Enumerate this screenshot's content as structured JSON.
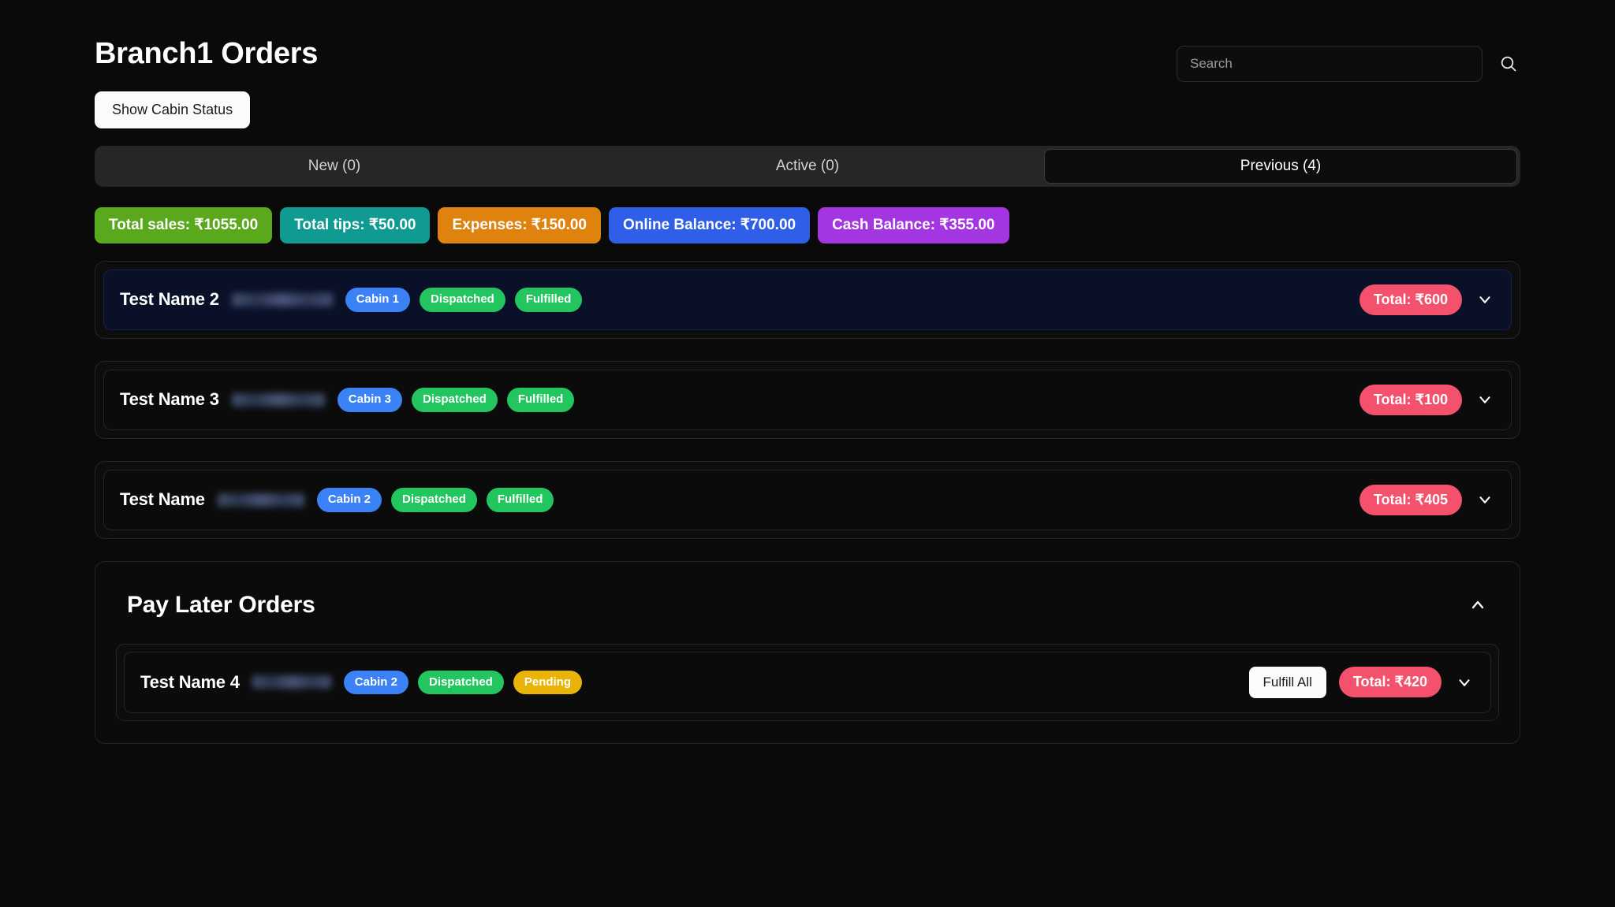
{
  "header": {
    "title": "Branch1 Orders",
    "search": {
      "placeholder": "Search",
      "value": ""
    },
    "search_icon": "search-icon"
  },
  "actions": {
    "show_cabin_status": "Show Cabin Status"
  },
  "tabs": [
    {
      "label": "New (0)",
      "active": false
    },
    {
      "label": "Active (0)",
      "active": false
    },
    {
      "label": "Previous (4)",
      "active": true
    }
  ],
  "summary": [
    {
      "label": "Total sales: ₹1055.00",
      "color": "#5aa81b"
    },
    {
      "label": "Total tips: ₹50.00",
      "color": "#0f9b91"
    },
    {
      "label": "Expenses: ₹150.00",
      "color": "#e0820e"
    },
    {
      "label": "Online Balance: ₹700.00",
      "color": "#2f5fe8"
    },
    {
      "label": "Cash Balance: ₹355.00",
      "color": "#a436e2"
    }
  ],
  "orders": [
    {
      "name": "Test Name 2",
      "redacted_width": 128,
      "highlight": true,
      "badges": [
        {
          "text": "Cabin 1",
          "color": "#3b82f6"
        },
        {
          "text": "Dispatched",
          "color": "#22c55e"
        },
        {
          "text": "Fulfilled",
          "color": "#22c55e"
        }
      ],
      "total": "Total: ₹600",
      "chevron": "chevron-down-icon"
    },
    {
      "name": "Test Name 3",
      "redacted_width": 118,
      "highlight": false,
      "badges": [
        {
          "text": "Cabin 3",
          "color": "#3b82f6"
        },
        {
          "text": "Dispatched",
          "color": "#22c55e"
        },
        {
          "text": "Fulfilled",
          "color": "#22c55e"
        }
      ],
      "total": "Total: ₹100",
      "chevron": "chevron-down-icon"
    },
    {
      "name": "Test Name",
      "redacted_width": 110,
      "highlight": false,
      "badges": [
        {
          "text": "Cabin 2",
          "color": "#3b82f6"
        },
        {
          "text": "Dispatched",
          "color": "#22c55e"
        },
        {
          "text": "Fulfilled",
          "color": "#22c55e"
        }
      ],
      "total": "Total: ₹405",
      "chevron": "chevron-down-icon"
    }
  ],
  "pay_later": {
    "title": "Pay Later Orders",
    "collapse_icon": "chevron-up-icon",
    "expanded": true,
    "orders": [
      {
        "name": "Test Name 4",
        "redacted_width": 100,
        "badges": [
          {
            "text": "Cabin 2",
            "color": "#3b82f6"
          },
          {
            "text": "Dispatched",
            "color": "#22c55e"
          },
          {
            "text": "Pending",
            "color": "#eab308"
          }
        ],
        "fulfill_label": "Fulfill All",
        "total": "Total: ₹420",
        "chevron": "chevron-down-icon"
      }
    ]
  }
}
